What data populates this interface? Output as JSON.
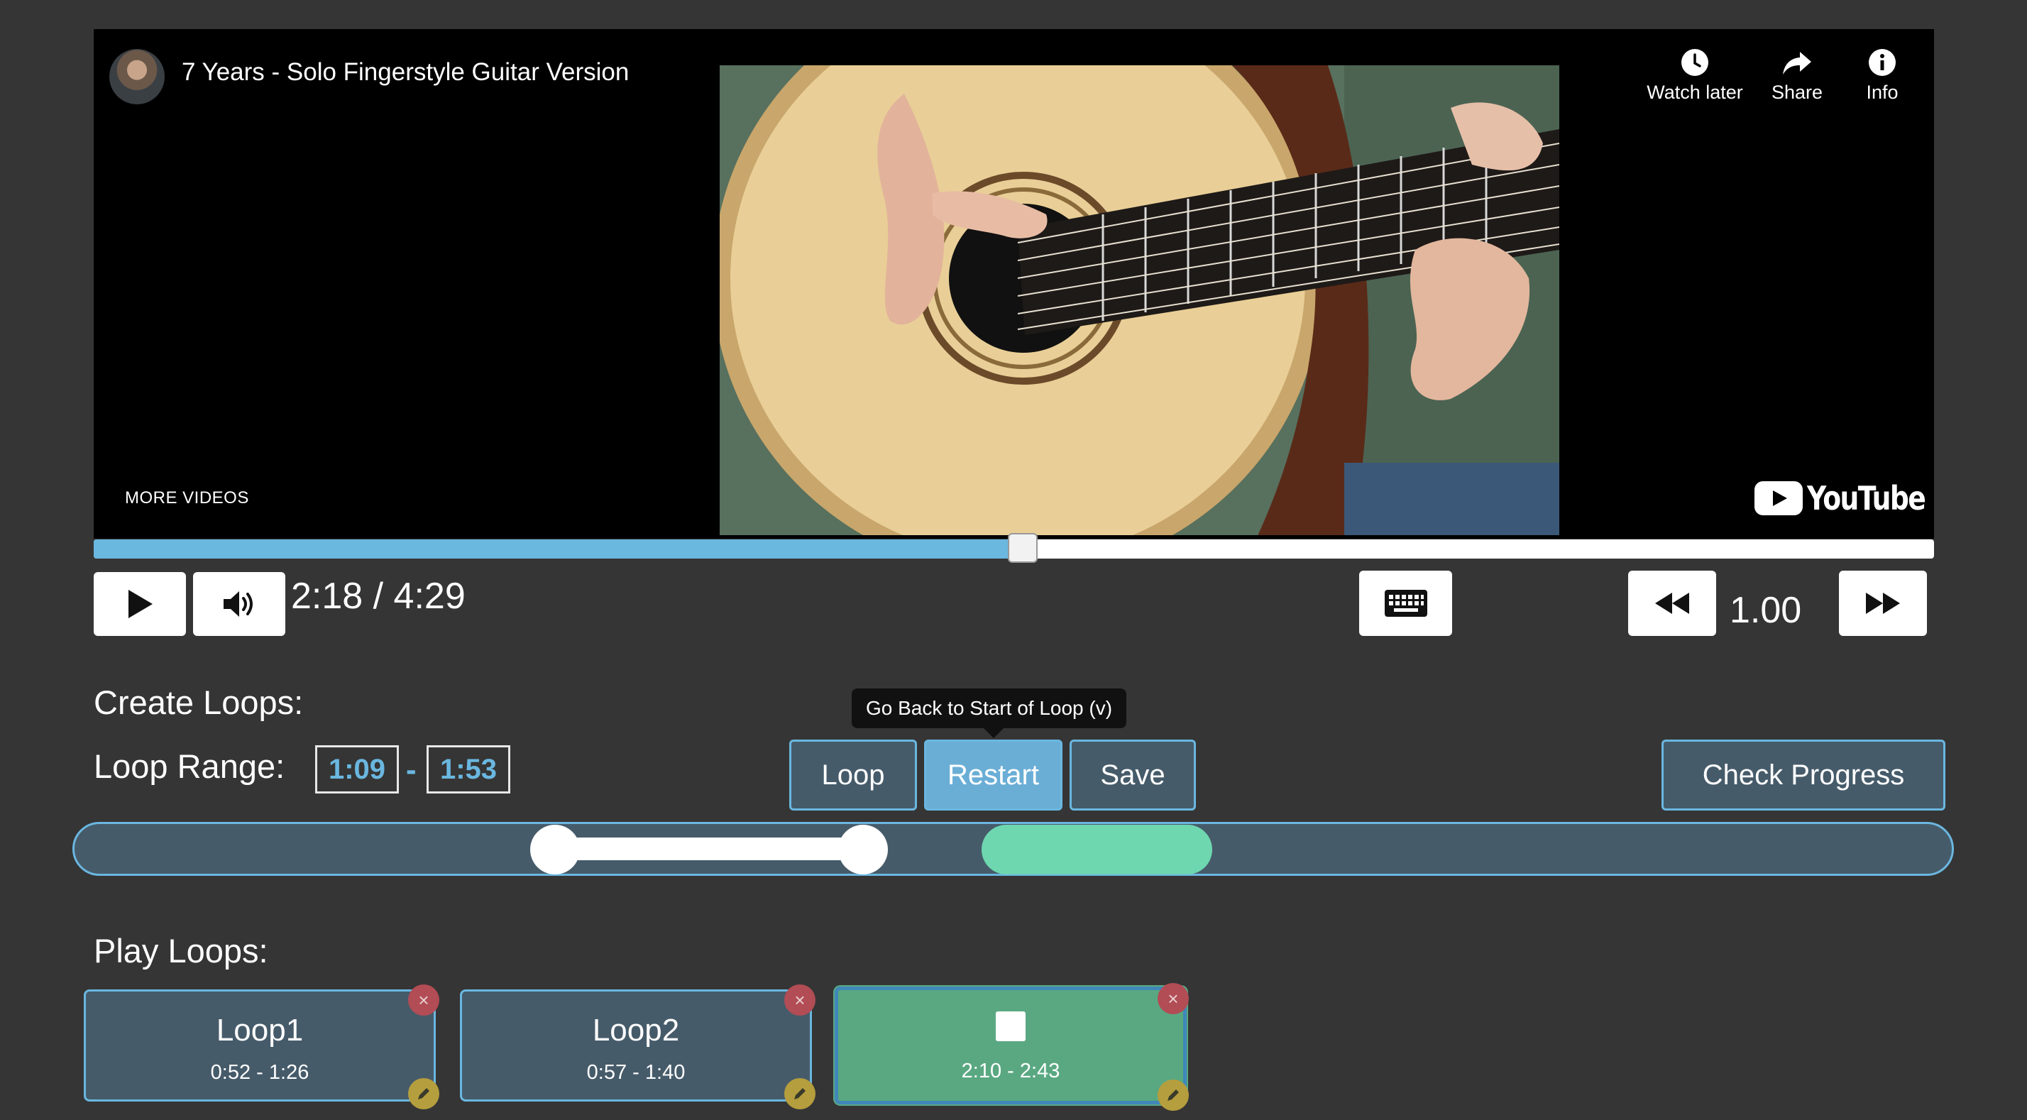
{
  "player": {
    "title": "7 Years - Solo Fingerstyle Guitar Version",
    "watch_later_label": "Watch later",
    "share_label": "Share",
    "info_label": "Info",
    "more_videos_label": "MORE VIDEOS",
    "youtube_logo_text": "YouTube",
    "progress_fraction": 0.505
  },
  "controls": {
    "time_display": "2:18 / 4:29",
    "playback_speed": "1.00",
    "icons": [
      "play-icon",
      "volume-icon",
      "keyboard-icon",
      "rewind-icon",
      "fast-forward-icon"
    ]
  },
  "create_loops": {
    "heading": "Create Loops:",
    "range_label": "Loop Range:",
    "range_start": "1:09",
    "range_separator": "-",
    "range_end": "1:53",
    "tooltip": "Go Back to Start of Loop (v)",
    "loop_button": "Loop",
    "restart_button": "Restart",
    "save_button": "Save",
    "check_progress_button": "Check Progress",
    "slider": {
      "duration_seconds": 269,
      "range_start_seconds": 69,
      "range_end_seconds": 113,
      "saved_highlight_start_seconds": 130,
      "saved_highlight_end_seconds": 163
    }
  },
  "play_loops": {
    "heading": "Play Loops:",
    "loops": [
      {
        "name": "Loop1",
        "range": "0:52 - 1:26",
        "active": false
      },
      {
        "name": "Loop2",
        "range": "0:57 - 1:40",
        "active": false
      },
      {
        "name": "",
        "range": "2:10 - 2:43",
        "active": true
      }
    ],
    "delete_glyph": "×"
  },
  "colors": {
    "background": "#353535",
    "accent_blue": "#6ab7e0",
    "panel": "#465b6a",
    "active_green": "#5aa882",
    "highlight_mint": "#6ed7b0",
    "delete_red": "#b24c55",
    "edit_gold": "#b59e3d"
  }
}
